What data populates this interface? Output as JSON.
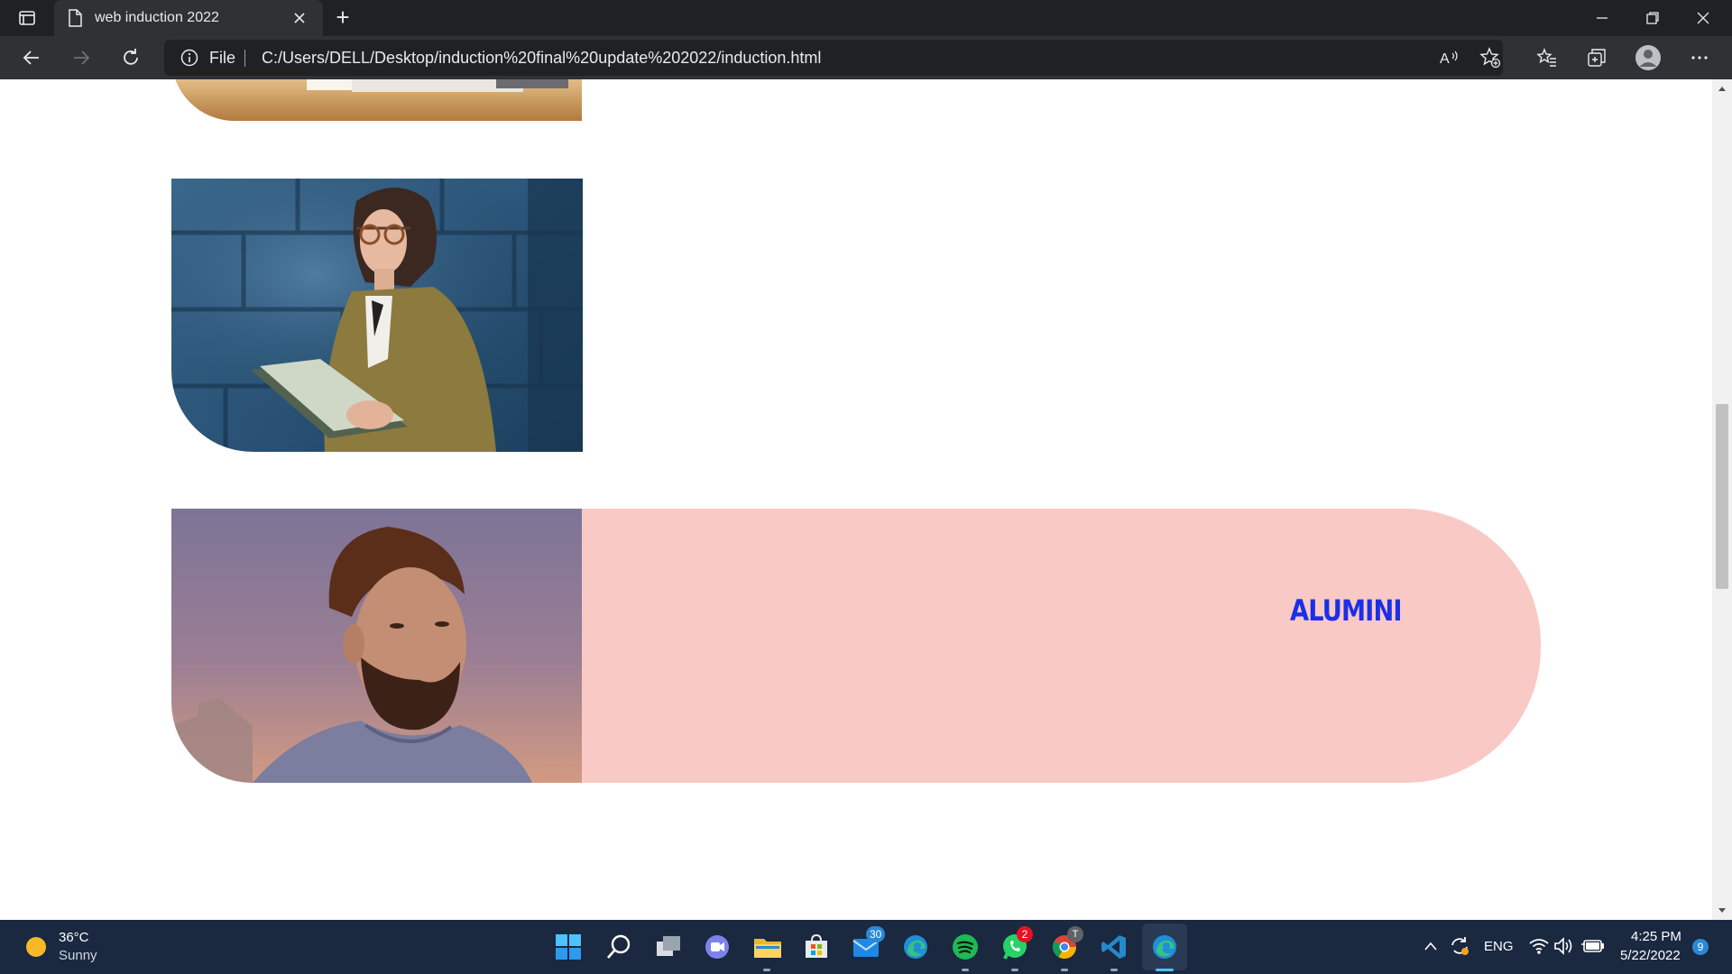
{
  "browser": {
    "tab_title": "web induction 2022",
    "new_tab_symbol": "+",
    "scheme_label": "File",
    "url": "C:/Users/DELL/Desktop/induction%20final%20update%202022/induction.html"
  },
  "page": {
    "alumini_title": "ALUMINI",
    "card_color": "#f9c9c6",
    "title_color": "#1a2fe8"
  },
  "taskbar": {
    "weather_temp": "36°C",
    "weather_desc": "Sunny",
    "mail_badge": "30",
    "whatsapp_badge": "2",
    "chrome_badge": "T",
    "language": "ENG",
    "time": "4:25 PM",
    "date": "5/22/2022",
    "notification_count": "9"
  }
}
